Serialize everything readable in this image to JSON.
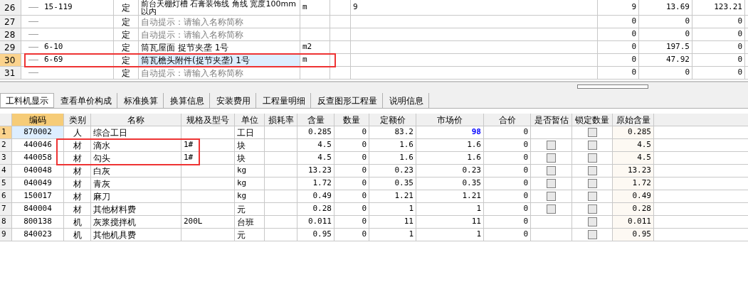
{
  "top_table": {
    "rows": [
      {
        "num": "26",
        "code": "15-119",
        "type": "定",
        "name": "前台天棚灯槽 石膏装饰线 角线 宽度100mm以内",
        "hint": false,
        "unit": "m",
        "column_7": "9",
        "column_8": "9",
        "column_9": "13.69",
        "column_10": "123.21",
        "selected": false
      },
      {
        "num": "27",
        "code": "",
        "type": "定",
        "name": "自动提示：请输入名称简称",
        "hint": true,
        "unit": "",
        "column_7": "",
        "column_8": "0",
        "column_9": "0",
        "column_10": "0",
        "selected": false
      },
      {
        "num": "28",
        "code": "",
        "type": "定",
        "name": "自动提示：请输入名称简称",
        "hint": true,
        "unit": "",
        "column_7": "",
        "column_8": "0",
        "column_9": "0",
        "column_10": "0",
        "selected": false
      },
      {
        "num": "29",
        "code": "6-10",
        "type": "定",
        "name": "筒瓦屋面 捉节夹垄 1号",
        "hint": false,
        "unit": "m2",
        "column_7": "",
        "column_8": "0",
        "column_9": "197.5",
        "column_10": "0",
        "selected": false
      },
      {
        "num": "30",
        "code": "6-69",
        "type": "定",
        "name": "筒瓦檐头附件(捉节夹垄) 1号",
        "hint": false,
        "unit": "m",
        "column_7": "",
        "column_8": "0",
        "column_9": "47.92",
        "column_10": "0",
        "selected": true
      },
      {
        "num": "31",
        "code": "",
        "type": "定",
        "name": "自动提示：请输入名称简称",
        "hint": true,
        "unit": "",
        "column_7": "",
        "column_8": "0",
        "column_9": "0",
        "column_10": "0",
        "selected": false
      }
    ]
  },
  "tabs": [
    {
      "label": "工料机显示",
      "selected": true
    },
    {
      "label": "查看单价构成",
      "selected": false
    },
    {
      "label": "标准换算",
      "selected": false
    },
    {
      "label": "换算信息",
      "selected": false
    },
    {
      "label": "安装费用",
      "selected": false
    },
    {
      "label": "工程量明细",
      "selected": false
    },
    {
      "label": "反查图形工程量",
      "selected": false
    },
    {
      "label": "说明信息",
      "selected": false
    }
  ],
  "detail_table": {
    "columns": [
      {
        "label": "编码",
        "selected": true
      },
      {
        "label": "类别",
        "selected": false
      },
      {
        "label": "名称",
        "selected": false
      },
      {
        "label": "规格及型号",
        "selected": false
      },
      {
        "label": "单位",
        "selected": false
      },
      {
        "label": "损耗率",
        "selected": false
      },
      {
        "label": "含量",
        "selected": false
      },
      {
        "label": "数量",
        "selected": false
      },
      {
        "label": "定额价",
        "selected": false
      },
      {
        "label": "市场价",
        "selected": false
      },
      {
        "label": "合价",
        "selected": false
      },
      {
        "label": "是否暂估",
        "selected": false
      },
      {
        "label": "锁定数量",
        "selected": false
      },
      {
        "label": "原始含量",
        "selected": false
      }
    ],
    "rows": [
      {
        "num": "1",
        "code": "870002",
        "category": "人",
        "name": "综合工日",
        "spec": "",
        "unit": "工日",
        "loss": "",
        "content": "0.285",
        "qty": "0",
        "quota_price": "83.2",
        "market_price": "98",
        "price_modified": true,
        "total": "0",
        "lock_checked": false,
        "original": "0.285",
        "selected": true
      },
      {
        "num": "2",
        "code": "440046",
        "category": "材",
        "name": "滴水",
        "spec": "1#",
        "unit": "块",
        "loss": "",
        "content": "4.5",
        "qty": "0",
        "quota_price": "1.6",
        "market_price": "1.6",
        "price_modified": false,
        "total": "0",
        "estimate_checked": false,
        "lock_checked": false,
        "original": "4.5",
        "selected": false
      },
      {
        "num": "3",
        "code": "440058",
        "category": "材",
        "name": "勾头",
        "spec": "1#",
        "unit": "块",
        "loss": "",
        "content": "4.5",
        "qty": "0",
        "quota_price": "1.6",
        "market_price": "1.6",
        "price_modified": false,
        "total": "0",
        "estimate_checked": false,
        "lock_checked": false,
        "original": "4.5",
        "selected": false
      },
      {
        "num": "4",
        "code": "040048",
        "category": "材",
        "name": "白灰",
        "spec": "",
        "unit": "kg",
        "loss": "",
        "content": "13.23",
        "qty": "0",
        "quota_price": "0.23",
        "market_price": "0.23",
        "price_modified": false,
        "total": "0",
        "estimate_checked": false,
        "lock_checked": false,
        "original": "13.23",
        "selected": false
      },
      {
        "num": "5",
        "code": "040049",
        "category": "材",
        "name": "青灰",
        "spec": "",
        "unit": "kg",
        "loss": "",
        "content": "1.72",
        "qty": "0",
        "quota_price": "0.35",
        "market_price": "0.35",
        "price_modified": false,
        "total": "0",
        "estimate_checked": false,
        "lock_checked": false,
        "original": "1.72",
        "selected": false
      },
      {
        "num": "6",
        "code": "150017",
        "category": "材",
        "name": "麻刀",
        "spec": "",
        "unit": "kg",
        "loss": "",
        "content": "0.49",
        "qty": "0",
        "quota_price": "1.21",
        "market_price": "1.21",
        "price_modified": false,
        "total": "0",
        "estimate_checked": false,
        "lock_checked": false,
        "original": "0.49",
        "selected": false
      },
      {
        "num": "7",
        "code": "840004",
        "category": "材",
        "name": "其他材料费",
        "spec": "",
        "unit": "元",
        "loss": "",
        "content": "0.28",
        "qty": "0",
        "quota_price": "1",
        "market_price": "1",
        "price_modified": false,
        "total": "0",
        "estimate_checked": false,
        "lock_checked": false,
        "original": "0.28",
        "selected": false
      },
      {
        "num": "8",
        "code": "800138",
        "category": "机",
        "name": "灰浆搅拌机",
        "spec": "200L",
        "unit": "台班",
        "loss": "",
        "content": "0.011",
        "qty": "0",
        "quota_price": "11",
        "market_price": "11",
        "price_modified": false,
        "total": "0",
        "lock_checked": false,
        "original": "0.011",
        "selected": false
      },
      {
        "num": "9",
        "code": "840023",
        "category": "机",
        "name": "其他机具费",
        "spec": "",
        "unit": "元",
        "loss": "",
        "content": "0.95",
        "qty": "0",
        "quota_price": "1",
        "market_price": "1",
        "price_modified": false,
        "total": "0",
        "lock_checked": false,
        "original": "0.95",
        "selected": false
      }
    ]
  }
}
